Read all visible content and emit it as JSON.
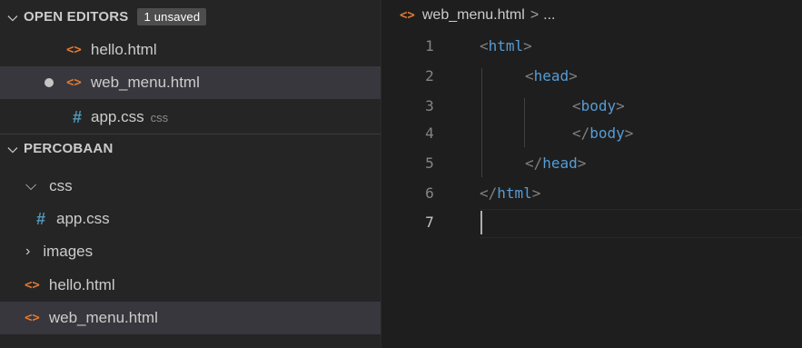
{
  "sidebar": {
    "open_editors": {
      "title": "OPEN EDITORS",
      "badge": "1 unsaved",
      "items": [
        {
          "label": "hello.html",
          "type": "html"
        },
        {
          "label": "web_menu.html",
          "type": "html",
          "unsaved": true,
          "selected": true
        },
        {
          "label": "app.css",
          "hint": "css",
          "type": "css"
        }
      ]
    },
    "explorer": {
      "title": "PERCOBAAN",
      "items": [
        {
          "label": "css",
          "type": "folder-open"
        },
        {
          "label": "app.css",
          "type": "css"
        },
        {
          "label": "images",
          "type": "folder-closed"
        },
        {
          "label": "hello.html",
          "type": "html"
        },
        {
          "label": "web_menu.html",
          "type": "html",
          "selected": true
        }
      ]
    }
  },
  "editor": {
    "breadcrumb": {
      "file": "web_menu.html",
      "separator": ">",
      "more": "..."
    },
    "active_line": 7,
    "lines": [
      {
        "num": "1",
        "tag": "html",
        "close": false
      },
      {
        "num": "2",
        "tag": "head",
        "close": false
      },
      {
        "num": "3",
        "tag": "body",
        "close": false
      },
      {
        "num": "4",
        "tag": "body",
        "close": true
      },
      {
        "num": "5",
        "tag": "head",
        "close": true
      },
      {
        "num": "6",
        "tag": "html",
        "close": true
      },
      {
        "num": "7",
        "tag": "",
        "close": false
      }
    ]
  },
  "icons": {
    "html": "code-brackets-icon",
    "css": "hash-icon",
    "unsaved": "unsaved-dot-icon",
    "folder_open": "chevron-down-icon",
    "folder_closed": "chevron-right-icon"
  },
  "colors": {
    "background": "#1e1e1e",
    "sidebar": "#252526",
    "selection": "#37373d",
    "html_icon": "#e37933",
    "css_icon": "#519aba",
    "tag": "#569cd6",
    "bracket": "#808080"
  }
}
